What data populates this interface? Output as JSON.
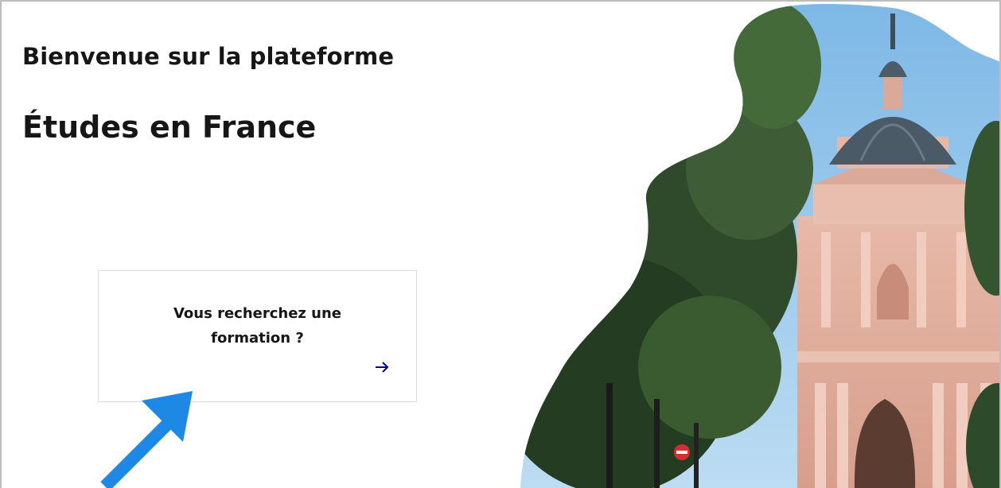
{
  "header": {
    "welcome": "Bienvenue sur la plateforme",
    "platform_name": "Études en France"
  },
  "search_card": {
    "title": "Vous recherchez une formation ?",
    "arrow_icon": "arrow-right-icon"
  },
  "hero_image": {
    "icon": "sorbonne-building-photo"
  },
  "annotation": {
    "icon": "pointer-arrow-icon",
    "color": "#1e88e5"
  },
  "colors": {
    "text": "#161616",
    "accent_arrow": "#000091",
    "card_border": "#dddddd",
    "sky": "#8fc4ea"
  }
}
